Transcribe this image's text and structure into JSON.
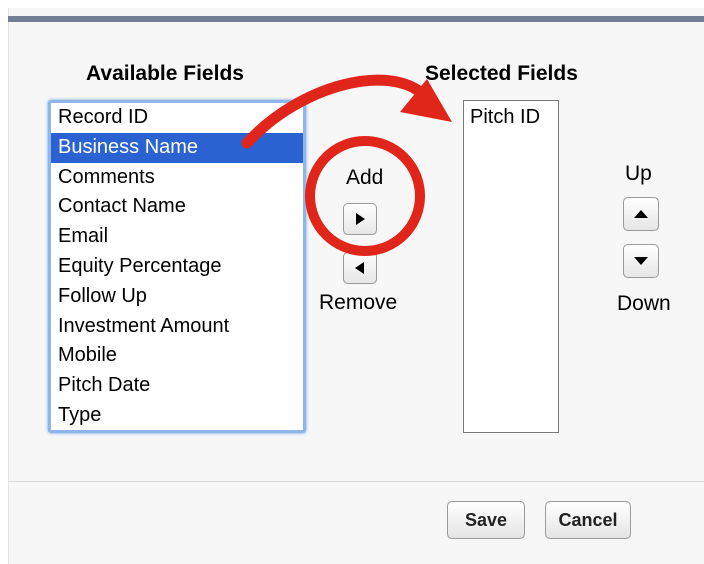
{
  "available": {
    "label": "Available Fields",
    "items": [
      "Record ID",
      "Business Name",
      "Comments",
      "Contact Name",
      "Email",
      "Equity Percentage",
      "Follow Up",
      "Investment Amount",
      "Mobile",
      "Pitch Date",
      "Type"
    ],
    "selected_item": "Business Name"
  },
  "selected": {
    "label": "Selected Fields",
    "items": [
      "Pitch ID"
    ]
  },
  "controls": {
    "add_label": "Add",
    "remove_label": "Remove",
    "up_label": "Up",
    "down_label": "Down"
  },
  "footer": {
    "save_label": "Save",
    "cancel_label": "Cancel"
  },
  "colors": {
    "selection": "#2b62d1",
    "annotation": "#e0251b",
    "header_bar": "#747d96",
    "focus_ring": "#8fb6e9"
  },
  "icons": {
    "add": "triangle-right-icon",
    "remove": "triangle-left-icon",
    "up": "triangle-up-icon",
    "down": "triangle-down-icon"
  }
}
